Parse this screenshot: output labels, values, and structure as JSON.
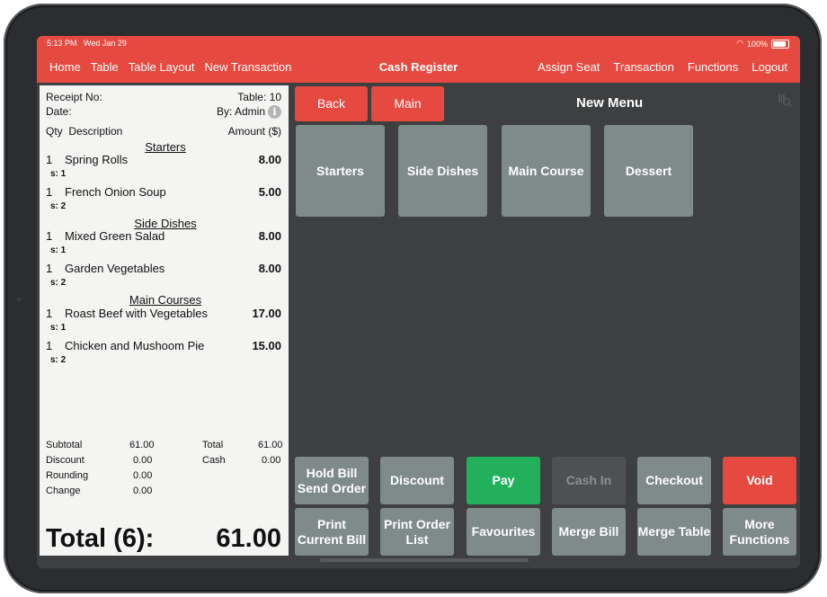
{
  "status": {
    "time": "5:13 PM",
    "date": "Wed Jan 29",
    "battery": "100%"
  },
  "nav": {
    "left": [
      "Home",
      "Table",
      "Table Layout",
      "New Transaction"
    ],
    "title": "Cash Register",
    "right": [
      "Assign Seat",
      "Transaction",
      "Functions",
      "Logout"
    ]
  },
  "receipt": {
    "receipt_no_label": "Receipt No:",
    "table": "Table: 10",
    "date_label": "Date:",
    "by": "By: Admin",
    "col_qty_desc": "Qty  Description",
    "col_amount": "Amount ($)",
    "sections": [
      {
        "title": "Starters",
        "items": [
          {
            "qty": "1",
            "desc": "Spring Rolls",
            "amount": "8.00",
            "seat": "s: 1"
          },
          {
            "qty": "1",
            "desc": "French Onion Soup",
            "amount": "5.00",
            "seat": "s: 2"
          }
        ]
      },
      {
        "title": "Side Dishes",
        "items": [
          {
            "qty": "1",
            "desc": "Mixed Green Salad",
            "amount": "8.00",
            "seat": "s: 1"
          },
          {
            "qty": "1",
            "desc": "Garden Vegetables",
            "amount": "8.00",
            "seat": "s: 2"
          }
        ]
      },
      {
        "title": "Main Courses",
        "items": [
          {
            "qty": "1",
            "desc": "Roast Beef with Vegetables",
            "amount": "17.00",
            "seat": "s: 1"
          },
          {
            "qty": "1",
            "desc": "Chicken and Mushoom Pie",
            "amount": "15.00",
            "seat": "s: 2"
          }
        ]
      }
    ],
    "summary": {
      "subtotal_label": "Subtotal",
      "subtotal": "61.00",
      "discount_label": "Discount",
      "discount": "0.00",
      "rounding_label": "Rounding",
      "rounding": "0.00",
      "change_label": "Change",
      "change": "0.00",
      "total_label": "Total",
      "total": "61.00",
      "cash_label": "Cash",
      "cash": "0.00"
    },
    "grand_total_label": "Total (6):",
    "grand_total": "61.00"
  },
  "menu": {
    "back": "Back",
    "main": "Main",
    "title": "New Menu",
    "categories": [
      "Starters",
      "Side Dishes",
      "Main Course",
      "Dessert"
    ]
  },
  "actions": {
    "hold": "Hold Bill\nSend Order",
    "discount": "Discount",
    "pay": "Pay",
    "cash_in": "Cash In",
    "checkout": "Checkout",
    "void": "Void",
    "print_bill": "Print\nCurrent Bill",
    "print_order": "Print Order\nList",
    "favourites": "Favourites",
    "merge_bill": "Merge Bill",
    "merge_table": "Merge Table",
    "more": "More\nFunctions"
  },
  "colors": {
    "accent": "#e5493f",
    "button": "#7f8b8b",
    "pay": "#23b05c",
    "panel": "#3e3f41"
  }
}
